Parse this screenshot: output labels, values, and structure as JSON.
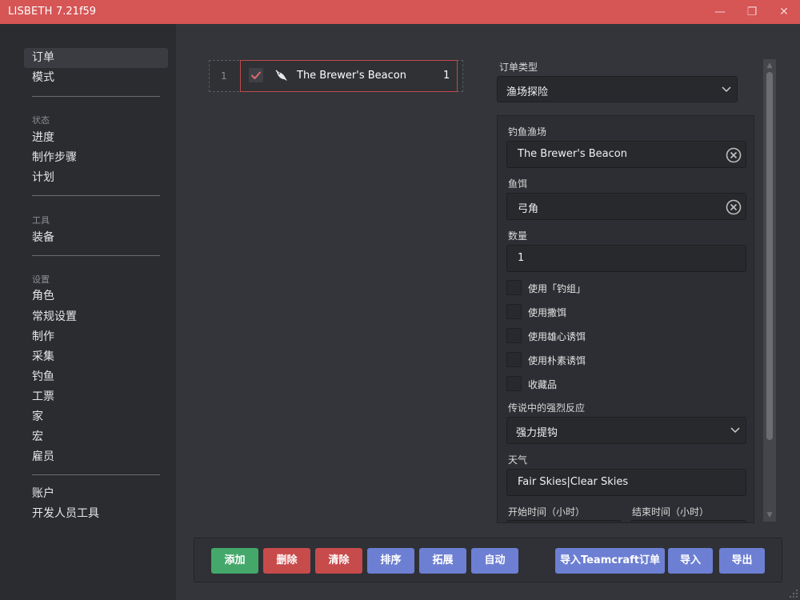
{
  "app": {
    "name": "LISBETH",
    "version": "7.21f59"
  },
  "window": {
    "minimize": "—",
    "maximize": "❐",
    "close": "✕"
  },
  "sidebar": {
    "top_items": [
      "订单",
      "模式"
    ],
    "status_title": "状态",
    "status_items": [
      "进度",
      "制作步骤",
      "计划"
    ],
    "tools_title": "工具",
    "tools_items": [
      "装备"
    ],
    "settings_title": "设置",
    "settings_items": [
      "角色",
      "常规设置",
      "制作",
      "采集",
      "钓鱼",
      "工票",
      "家",
      "宏",
      "雇员"
    ],
    "bottom_items": [
      "账户",
      "开发人员工具"
    ]
  },
  "order": {
    "index": "1",
    "name": "The Brewer's Beacon",
    "quantity": "1",
    "checked": true
  },
  "form": {
    "order_type_label": "订单类型",
    "order_type_value": "渔场探险",
    "fishing_spot_label": "钓鱼渔场",
    "fishing_spot_value": "The Brewer's Beacon",
    "bait_label": "鱼饵",
    "bait_value": "弓角",
    "quantity_label": "数量",
    "quantity_value": "1",
    "checkboxes": [
      "使用「钓组」",
      "使用撒饵",
      "使用雄心诱饵",
      "使用朴素诱饵",
      "收藏品"
    ],
    "legend_label": "传说中的强烈反应",
    "legend_value": "强力提钩",
    "weather_label": "天气",
    "weather_value": "Fair Skies|Clear Skies",
    "start_time_label": "开始时间（小时）",
    "end_time_label": "结束时间（小时）"
  },
  "toolbar": {
    "add": "添加",
    "delete": "删除",
    "clear": "清除",
    "sort": "排序",
    "expand": "拓展",
    "auto": "自动",
    "import_teamcraft": "导入Teamcraft订单",
    "import": "导入",
    "export": "导出"
  },
  "colors": {
    "titlebar": "#d65555",
    "green": "#45a86b",
    "red": "#c84b4b",
    "blue": "#6d7fd2",
    "check": "#e06b6b"
  }
}
